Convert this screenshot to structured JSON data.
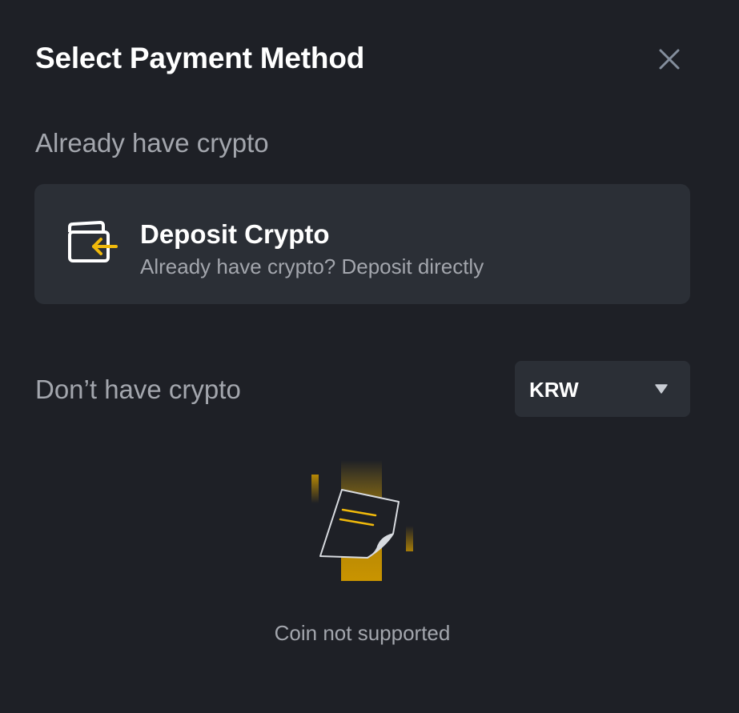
{
  "modal": {
    "title": "Select Payment Method",
    "close_icon": "close-icon"
  },
  "already_section": {
    "label": "Already have crypto",
    "deposit_card": {
      "icon": "wallet-deposit-icon",
      "title": "Deposit Crypto",
      "subtitle": "Already have crypto? Deposit directly"
    }
  },
  "dont_section": {
    "label": "Don’t have crypto",
    "currency_select": {
      "value": "KRW",
      "icon": "caret-down-icon"
    }
  },
  "empty_state": {
    "icon": "no-data-illustration",
    "message": "Coin not supported"
  },
  "colors": {
    "background": "#1e2026",
    "card": "#2b2f36",
    "accent": "#f0b90b",
    "text_primary": "#ffffff",
    "text_secondary": "#a3a6ad"
  }
}
